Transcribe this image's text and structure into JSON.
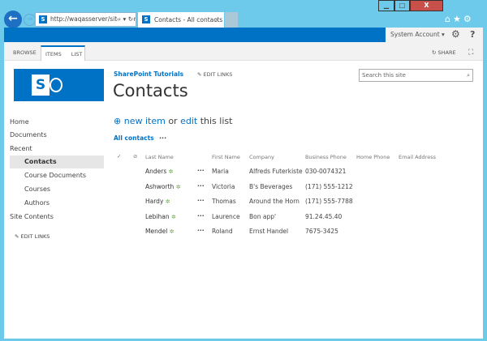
{
  "browser": {
    "url": "http://waqasserver/sites/dem",
    "tab_title": "Contacts - All contacts",
    "controls": {
      "minimize": "▁",
      "maximize": "□",
      "close": "X"
    }
  },
  "suitebar": {
    "account": "System Account",
    "settings_icon": "gear-icon",
    "help": "?"
  },
  "ribbon": {
    "tabs": [
      "BROWSE",
      "ITEMS",
      "LIST"
    ],
    "active_tab": "ITEMS",
    "share": "SHARE"
  },
  "site": {
    "logo_letter": "S",
    "name": "SharePoint Tutorials",
    "edit_links": "EDIT LINKS",
    "search_placeholder": "Search this site",
    "title": "Contacts"
  },
  "nav": {
    "items": [
      "Home",
      "Documents",
      "Recent",
      "Contacts",
      "Course Documents",
      "Courses",
      "Authors",
      "Site Contents"
    ],
    "selected": "Contacts",
    "edit_links": "EDIT LINKS"
  },
  "actions": {
    "new_item": "new item",
    "or": "or",
    "edit": "edit",
    "this_list": "this list"
  },
  "views": {
    "current": "All contacts",
    "more": "..."
  },
  "table": {
    "columns": [
      "Last Name",
      "First Name",
      "Company",
      "Business Phone",
      "Home Phone",
      "Email Address"
    ],
    "rows": [
      {
        "last": "Anders",
        "first": "Maria",
        "company": "Alfreds Futerkiste",
        "phone": "030-0074321"
      },
      {
        "last": "Ashworth",
        "first": "Victoria",
        "company": "B's Beverages",
        "phone": "(171) 555-1212"
      },
      {
        "last": "Hardy",
        "first": "Thomas",
        "company": "Around the Horn",
        "phone": "(171) 555-7788"
      },
      {
        "last": "Lebihan",
        "first": "Laurence",
        "company": "Bon app'",
        "phone": "91.24.45.40"
      },
      {
        "last": "Mendel",
        "first": "Roland",
        "company": "Ernst Handel",
        "phone": "7675-3425"
      }
    ]
  },
  "colors": {
    "brand": "#0072c6",
    "frame": "#6dcaea",
    "new_badge": "#6aa84f"
  }
}
